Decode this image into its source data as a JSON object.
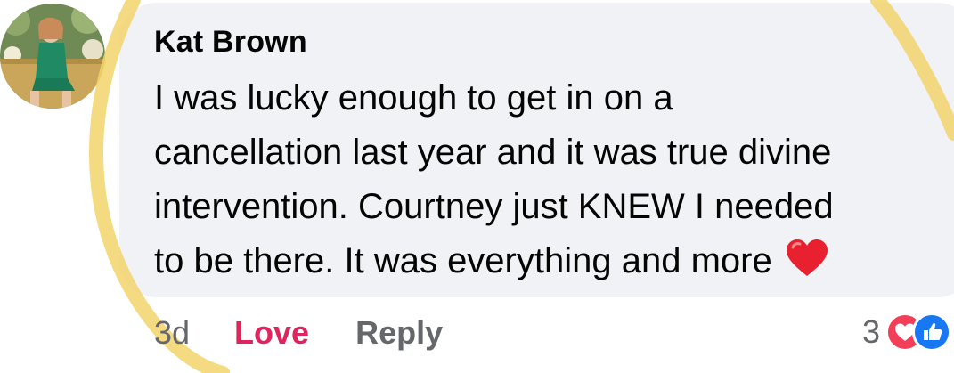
{
  "comment": {
    "author": "Kat Brown",
    "lines": [
      "I was lucky enough to get in on a",
      "cancellation last year and it was true divine",
      "intervention. Courtney just KNEW I needed",
      "to be there. It was everything and more"
    ],
    "emoji": "red-heart-icon"
  },
  "actions": {
    "timestamp": "3d",
    "love_label": "Love",
    "reply_label": "Reply"
  },
  "reactions": {
    "count": "3",
    "types": [
      "love",
      "like"
    ]
  },
  "colors": {
    "bubble": "#f0f2f5",
    "text": "#050505",
    "muted": "#65676b",
    "love": "#e0245e",
    "heart": "#f33e58",
    "like": "#1877f2",
    "highlight": "#f2d36b"
  }
}
